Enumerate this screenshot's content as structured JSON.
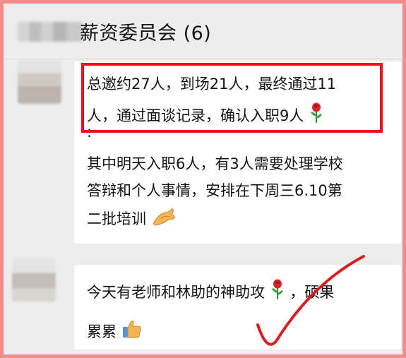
{
  "header": {
    "title": "薪资委员会 (6)"
  },
  "messages": [
    {
      "line1": "总邀约27人，到场21人，最终通过11",
      "line2": "人，通过面谈记录，确认入职9人",
      "dot": ":",
      "line3": "其中明天入职6人，有3人需要处理学校",
      "line4": "答辩和个人事情，安排在下周三6.10第",
      "line5": "二批培训",
      "emoji_rose": "rose-icon",
      "emoji_hand": "ok-hand-icon"
    },
    {
      "line1a": "今天有老师和林助的神助攻",
      "line1b": "，硕果",
      "line2": "累累",
      "emoji_rose": "rose-icon",
      "emoji_thumb": "thumbs-up-icon"
    }
  ],
  "colors": {
    "highlight_box": "#e8121b",
    "check_mark": "#d81e1e",
    "border": "#f08c8c"
  }
}
